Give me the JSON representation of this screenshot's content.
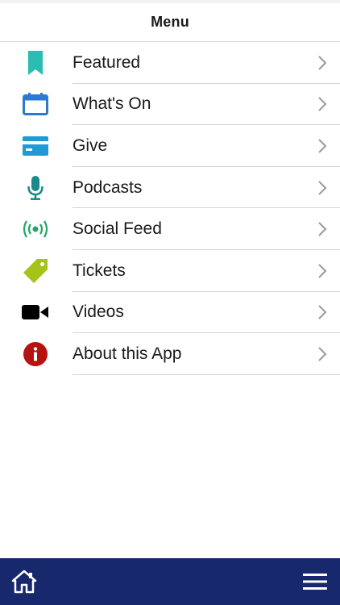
{
  "header": {
    "title": "Menu"
  },
  "menu": {
    "items": [
      {
        "label": "Featured",
        "icon": "bookmark-icon",
        "icon_color": "#2bbdb1"
      },
      {
        "label": "What's On",
        "icon": "calendar-icon",
        "icon_color": "#2b79d2"
      },
      {
        "label": "Give",
        "icon": "credit-card-icon",
        "icon_color": "#1f9ad6"
      },
      {
        "label": "Podcasts",
        "icon": "microphone-icon",
        "icon_color": "#1a8a8c"
      },
      {
        "label": "Social Feed",
        "icon": "broadcast-icon",
        "icon_color": "#22a569"
      },
      {
        "label": "Tickets",
        "icon": "tag-icon",
        "icon_color": "#a5c419"
      },
      {
        "label": "Videos",
        "icon": "video-camera-icon",
        "icon_color": "#000000"
      },
      {
        "label": "About this App",
        "icon": "info-icon",
        "icon_color": "#b51211"
      }
    ]
  },
  "bottom_bar": {
    "background": "#17286d",
    "left_icon": "home-icon",
    "right_icon": "hamburger-menu-icon"
  }
}
